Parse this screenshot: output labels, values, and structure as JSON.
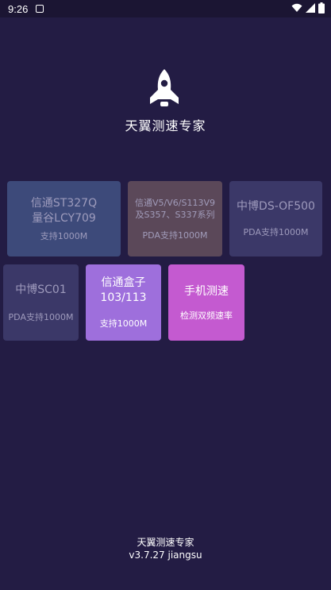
{
  "status_bar": {
    "time": "9:26",
    "icons": [
      "notification-icon",
      "wifi-icon",
      "signal-icon",
      "battery-icon"
    ]
  },
  "app": {
    "title": "天翼测速专家",
    "logo_icon": "rocket-icon"
  },
  "tiles": [
    {
      "line1": "信通ST327Q",
      "line2": "量谷LCY709",
      "sub": "支持1000M",
      "color": "#3d4a7a"
    },
    {
      "line1": "信通V5/V6/S113V9",
      "line2": "及S357、S337系列",
      "sub": "PDA支持1000M",
      "color": "#5b4859"
    },
    {
      "line1": "中博DS-OF500",
      "sub": "PDA支持1000M",
      "color": "#3b3868"
    },
    {
      "line1": "中博SC01",
      "sub": "PDA支持1000M",
      "color": "#3b3868"
    },
    {
      "line1": "信通盒子",
      "line2": "103/113",
      "sub": "支持1000M",
      "color": "#9e6fdc"
    },
    {
      "line1": "手机测速",
      "sub": "检测双频速率",
      "color": "#c45ad0"
    }
  ],
  "footer": {
    "app_name": "天翼测速专家",
    "version": "v3.7.27 jiangsu"
  }
}
